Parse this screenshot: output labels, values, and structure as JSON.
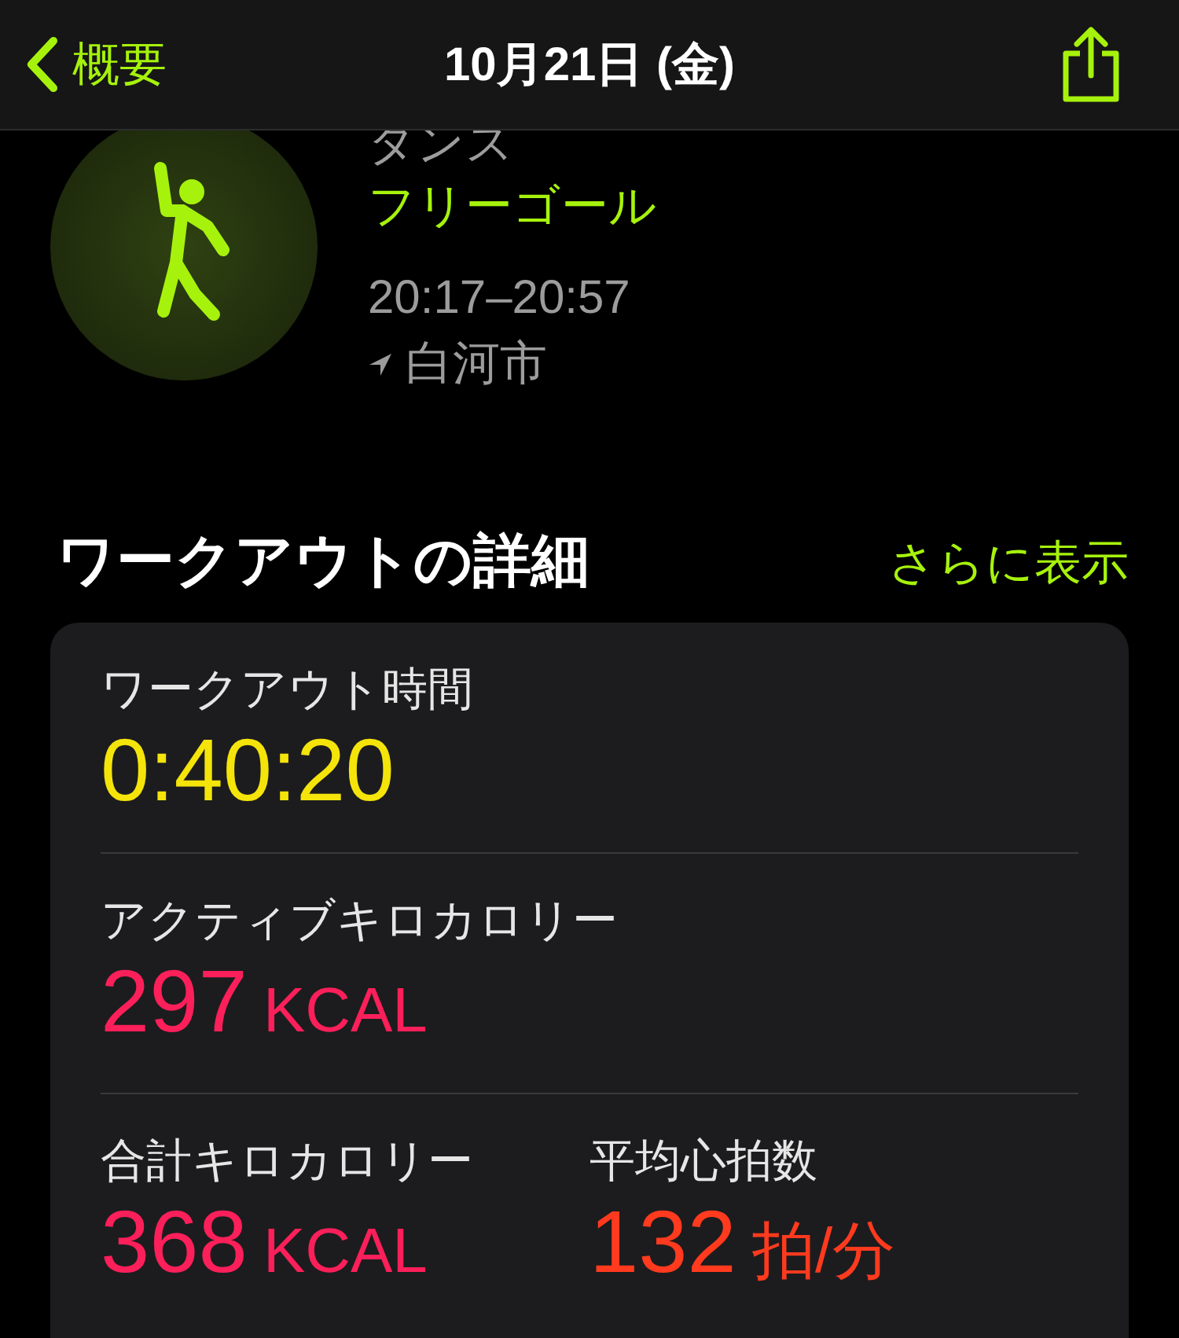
{
  "header": {
    "back_label": "概要",
    "title": "10月21日 (金)"
  },
  "workout": {
    "type": "タンス",
    "goal": "フリーゴール",
    "time": "20:17–20:57",
    "location": "白河市"
  },
  "details": {
    "title": "ワークアウトの詳細",
    "more_link": "さらに表示",
    "rows": [
      [
        {
          "label": "ワークアウト時間",
          "value": "0:40:20",
          "color": "#f4e40a"
        }
      ],
      [
        {
          "label": "アクティブキロカロリー",
          "value": "297",
          "unit": "KCAL",
          "color": "#fb1f5a"
        }
      ],
      [
        {
          "label": "合計キロカロリー",
          "value": "368",
          "unit": "KCAL",
          "color": "#fb1f5a"
        },
        {
          "label": "平均心拍数",
          "value": "132",
          "unit": "拍/分",
          "color": "#ff3a1e"
        }
      ]
    ]
  }
}
